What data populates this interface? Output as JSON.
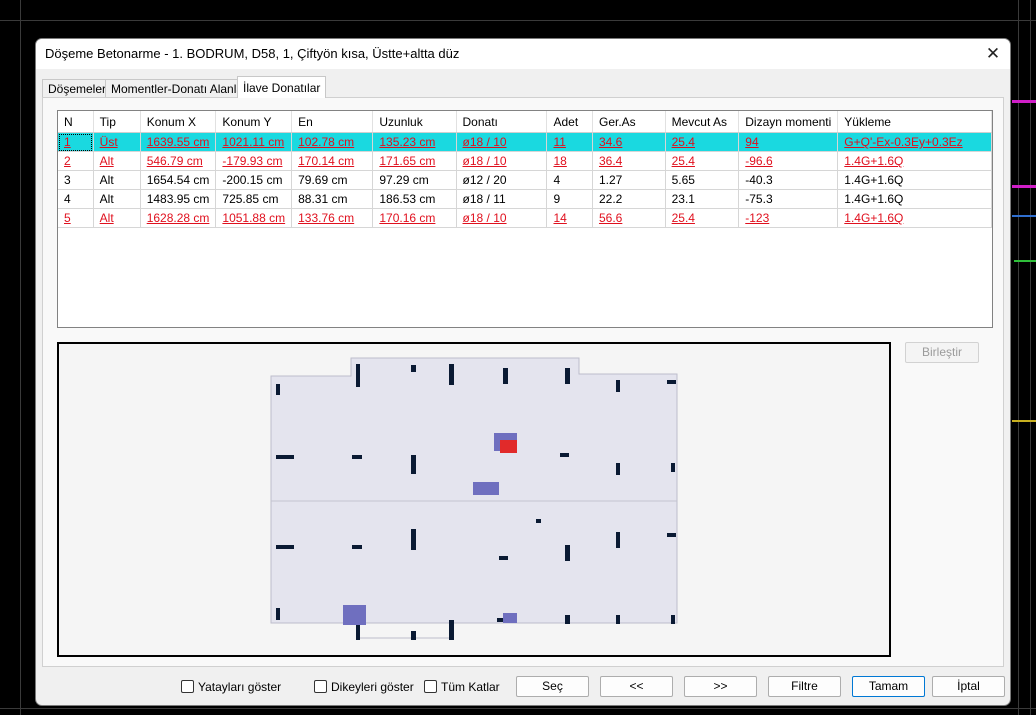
{
  "window": {
    "title": "Döşeme Betonarme - 1. BODRUM, D58, 1, Çiftyön kısa, Üstte+altta düz",
    "close_glyph": "✕"
  },
  "tabs": [
    {
      "label": "Döşemeler"
    },
    {
      "label": "Momentler-Donatı Alanları"
    },
    {
      "label": "İlave Donatılar",
      "active": true
    }
  ],
  "table": {
    "columns": [
      "N",
      "Tip",
      "Konum X",
      "Konum Y",
      "En",
      "Uzunluk",
      "Donatı",
      "Adet",
      "Ger.As",
      "Mevcut As",
      "Dizayn momenti",
      "Yükleme"
    ],
    "rows": [
      {
        "state": "selected",
        "cells": [
          "1",
          "Üst",
          "1639.55 cm",
          "1021.11 cm",
          "102.78 cm",
          "135.23 cm",
          "ø18 / 10",
          "11",
          "34.6",
          "25.4",
          "94",
          "G+Q'-Ex-0.3Ey+0.3Ez"
        ]
      },
      {
        "state": "red",
        "cells": [
          "2",
          "Alt",
          "546.79 cm",
          "-179.93 cm",
          "170.14 cm",
          "171.65 cm",
          "ø18 / 10",
          "18",
          "36.4",
          "25.4",
          "-96.6",
          "1.4G+1.6Q"
        ]
      },
      {
        "state": "normal",
        "cells": [
          "3",
          "Alt",
          "1654.54 cm",
          "-200.15 cm",
          "79.69 cm",
          "97.29 cm",
          "ø12 / 20",
          "4",
          "1.27",
          "5.65",
          "-40.3",
          "1.4G+1.6Q"
        ]
      },
      {
        "state": "normal",
        "cells": [
          "4",
          "Alt",
          "1483.95 cm",
          "725.85 cm",
          "88.31 cm",
          "186.53 cm",
          "ø18 / 11",
          "9",
          "22.2",
          "23.1",
          "-75.3",
          "1.4G+1.6Q"
        ]
      },
      {
        "state": "red",
        "cells": [
          "5",
          "Alt",
          "1628.28 cm",
          "1051.88 cm",
          "133.76 cm",
          "170.16 cm",
          "ø18 / 10",
          "14",
          "56.6",
          "25.4",
          "-123",
          "1.4G+1.6Q"
        ]
      }
    ]
  },
  "buttons": {
    "birlestir": "Birleştir",
    "sec": "Seç",
    "prev": "<<",
    "next": ">>",
    "filtre": "Filtre",
    "tamam": "Tamam",
    "iptal": "İptal"
  },
  "checkboxes": {
    "yataylari": "Yatayları göster",
    "dikeyleri": "Dikeyleri göster",
    "tum_katlar": "Tüm Katlar"
  },
  "colors": {
    "selected_row": "#1ad9e0",
    "red_text": "#e0101e",
    "slab_fill": "#e4e4ee",
    "rebar_blue": "#6f6fbf",
    "rebar_red": "#e12a2a",
    "column": "#0a1a33"
  }
}
